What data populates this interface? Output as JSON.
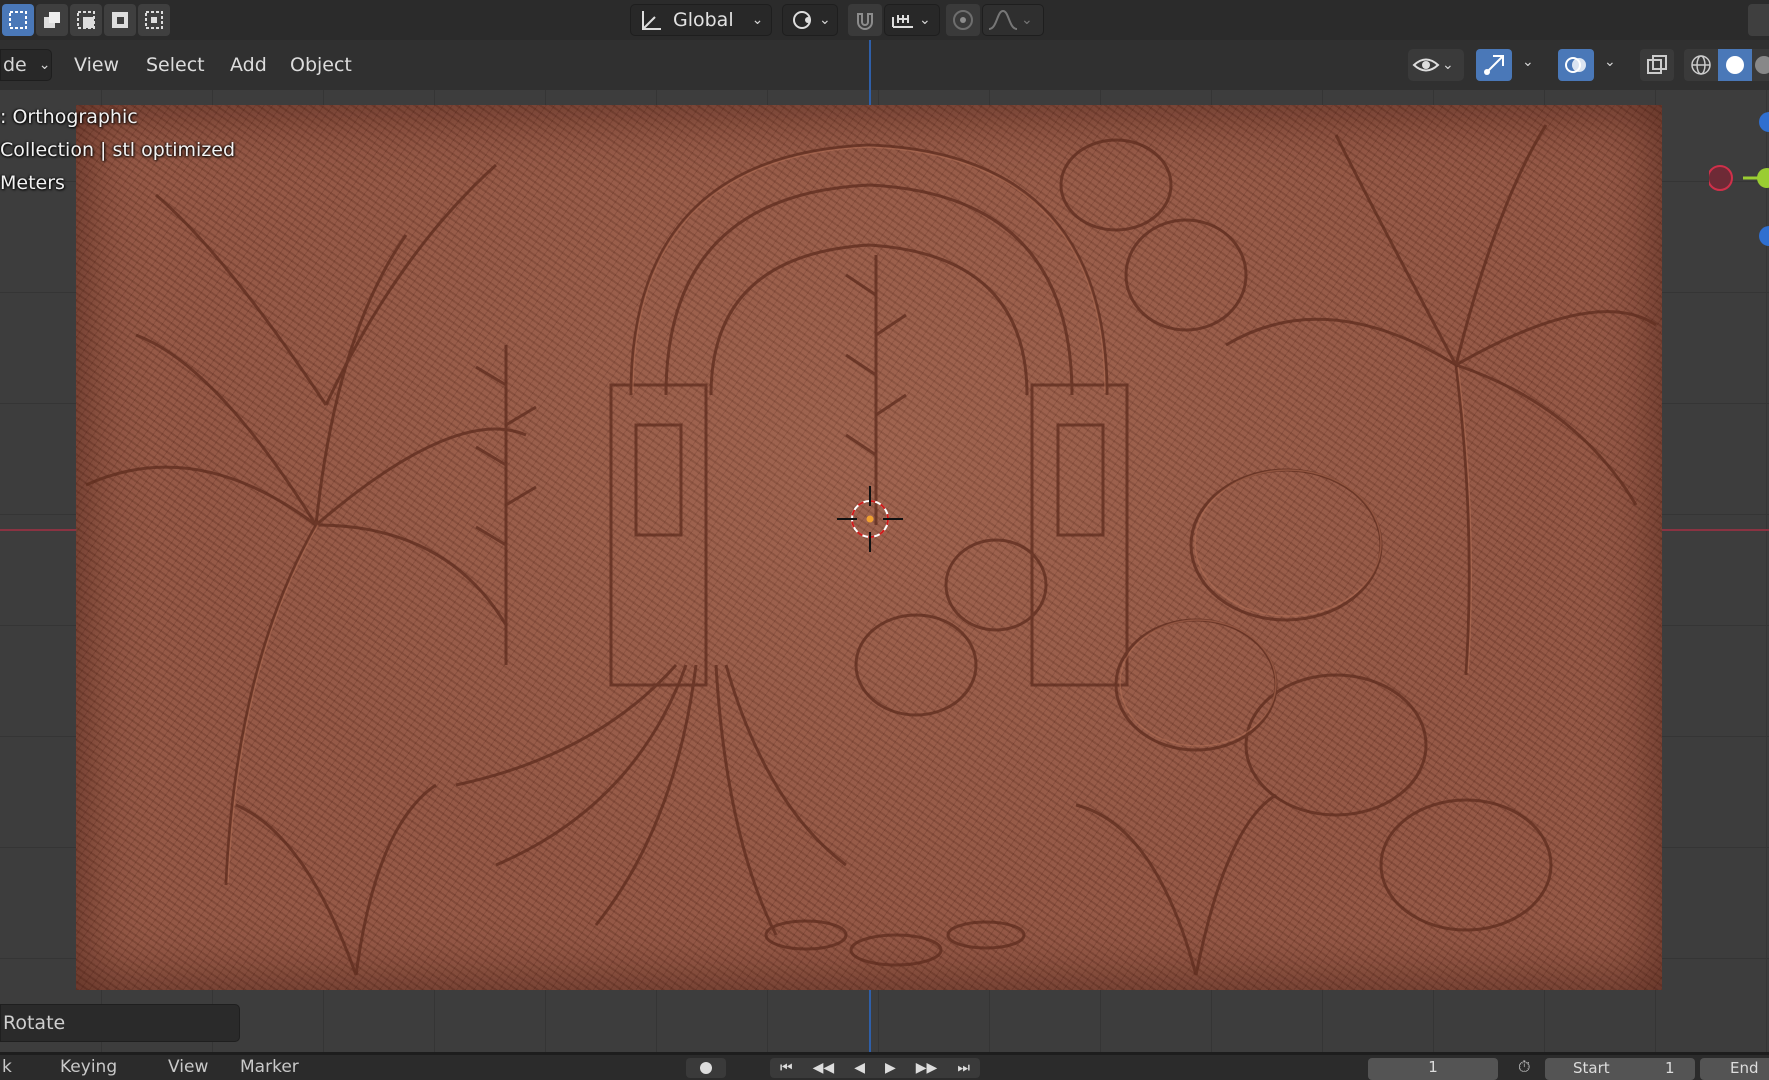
{
  "header": {
    "transform_orientation": "Global",
    "menu": [
      "de",
      "View",
      "Select",
      "Add",
      "Object"
    ]
  },
  "viewport": {
    "view_name": ": Orthographic",
    "collection": "Collection | stl optimized",
    "units": "Meters"
  },
  "operator_panel": {
    "label": "Rotate"
  },
  "timeline": {
    "menu": [
      "k",
      "Keying",
      "View",
      "Marker"
    ],
    "current_frame": "1",
    "start_label": "Start",
    "start_value": "1",
    "end_label": "End"
  },
  "colors": {
    "relief": "#8e4d3a",
    "x_axis": "#8a3342",
    "y_axis": "#2f5fa8",
    "active_blue": "#4a78b8"
  }
}
